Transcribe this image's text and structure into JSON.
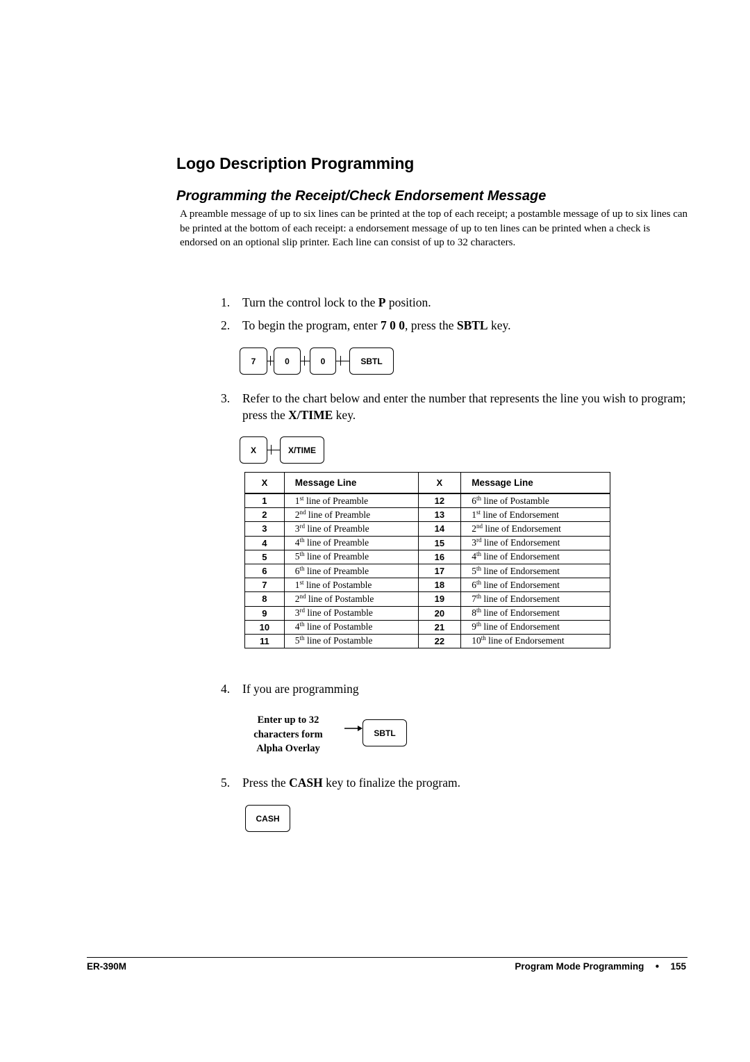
{
  "page": {
    "title": "Logo Description Programming",
    "section_title": "Programming the Receipt/Check Endorsement Message",
    "intro": "A preamble message of up to six lines can be printed at the top of each receipt; a postamble message of up to six lines can be printed at the bottom of each receipt: a endorsement message of up to ten lines can be printed when a check is endorsed on an optional slip printer. Each line can consist of up to 32 characters."
  },
  "steps": [
    {
      "num": "1.",
      "parts": [
        {
          "t": "Turn the control lock to the "
        },
        {
          "t": "P",
          "b": true
        },
        {
          "t": " position."
        }
      ]
    },
    {
      "num": "2.",
      "parts": [
        {
          "t": "To begin the program, enter "
        },
        {
          "t": "7 0 0",
          "b": true
        },
        {
          "t": ", press the "
        },
        {
          "t": "SBTL",
          "b": true
        },
        {
          "t": " key."
        }
      ]
    },
    {
      "num": "3.",
      "parts": [
        {
          "t": "Refer to the chart below and enter the number that represents the line you wish to program; press the "
        },
        {
          "t": "X/TIME",
          "b": true
        },
        {
          "t": " key."
        }
      ]
    },
    {
      "num": "4.",
      "parts": [
        {
          "t": "If you are programming"
        }
      ]
    },
    {
      "num": "5.",
      "parts": [
        {
          "t": "Press the "
        },
        {
          "t": "CASH",
          "b": true
        },
        {
          "t": " key to finalize the program."
        }
      ]
    }
  ],
  "key_sequences": {
    "step2": [
      "7",
      "0",
      "0",
      "SBTL"
    ],
    "step3": [
      "X",
      "X/TIME"
    ],
    "step4": {
      "note_lines": [
        "Enter up to 32",
        "characters form",
        "Alpha Overlay"
      ],
      "key": "SBTL"
    },
    "step5": [
      "CASH"
    ]
  },
  "table": {
    "headers": {
      "x": "X",
      "message_line": "Message Line"
    },
    "left": [
      {
        "x": "1",
        "ord": "1",
        "sup": "st",
        "rest": " line of Preamble"
      },
      {
        "x": "2",
        "ord": "2",
        "sup": "nd",
        "rest": " line of Preamble"
      },
      {
        "x": "3",
        "ord": "3",
        "sup": "rd",
        "rest": " line of Preamble"
      },
      {
        "x": "4",
        "ord": "4",
        "sup": "th",
        "rest": " line of Preamble"
      },
      {
        "x": "5",
        "ord": "5",
        "sup": "th",
        "rest": " line of Preamble"
      },
      {
        "x": "6",
        "ord": "6",
        "sup": "th",
        "rest": " line of Preamble"
      },
      {
        "x": "7",
        "ord": "1",
        "sup": "st",
        "rest": " line of Postamble"
      },
      {
        "x": "8",
        "ord": "2",
        "sup": "nd",
        "rest": " line of Postamble"
      },
      {
        "x": "9",
        "ord": "3",
        "sup": "rd",
        "rest": " line of Postamble"
      },
      {
        "x": "10",
        "ord": "4",
        "sup": "th",
        "rest": " line of Postamble"
      },
      {
        "x": "11",
        "ord": "5",
        "sup": "th",
        "rest": " line of Postamble"
      }
    ],
    "right": [
      {
        "x": "12",
        "ord": "6",
        "sup": "th",
        "rest": " line of Postamble"
      },
      {
        "x": "13",
        "ord": "1",
        "sup": "st",
        "rest": " line of Endorsement"
      },
      {
        "x": "14",
        "ord": "2",
        "sup": "nd",
        "rest": " line of Endorsement"
      },
      {
        "x": "15",
        "ord": "3",
        "sup": "rd",
        "rest": " line of Endorsement"
      },
      {
        "x": "16",
        "ord": "4",
        "sup": "th",
        "rest": " line of Endorsement"
      },
      {
        "x": "17",
        "ord": "5",
        "sup": "th",
        "rest": " line of Endorsement"
      },
      {
        "x": "18",
        "ord": "6",
        "sup": "th",
        "rest": " line of Endorsement"
      },
      {
        "x": "19",
        "ord": "7",
        "sup": "th",
        "rest": " line of Endorsement"
      },
      {
        "x": "20",
        "ord": "8",
        "sup": "th",
        "rest": " line of Endorsement"
      },
      {
        "x": "21",
        "ord": "9",
        "sup": "th",
        "rest": " line of Endorsement"
      },
      {
        "x": "22",
        "ord": "10",
        "sup": "th",
        "rest": " line of Endorsement"
      }
    ]
  },
  "footer": {
    "model": "ER-390M",
    "chapter": "Program Mode Programming",
    "bullet": "●",
    "page_number": "155"
  }
}
